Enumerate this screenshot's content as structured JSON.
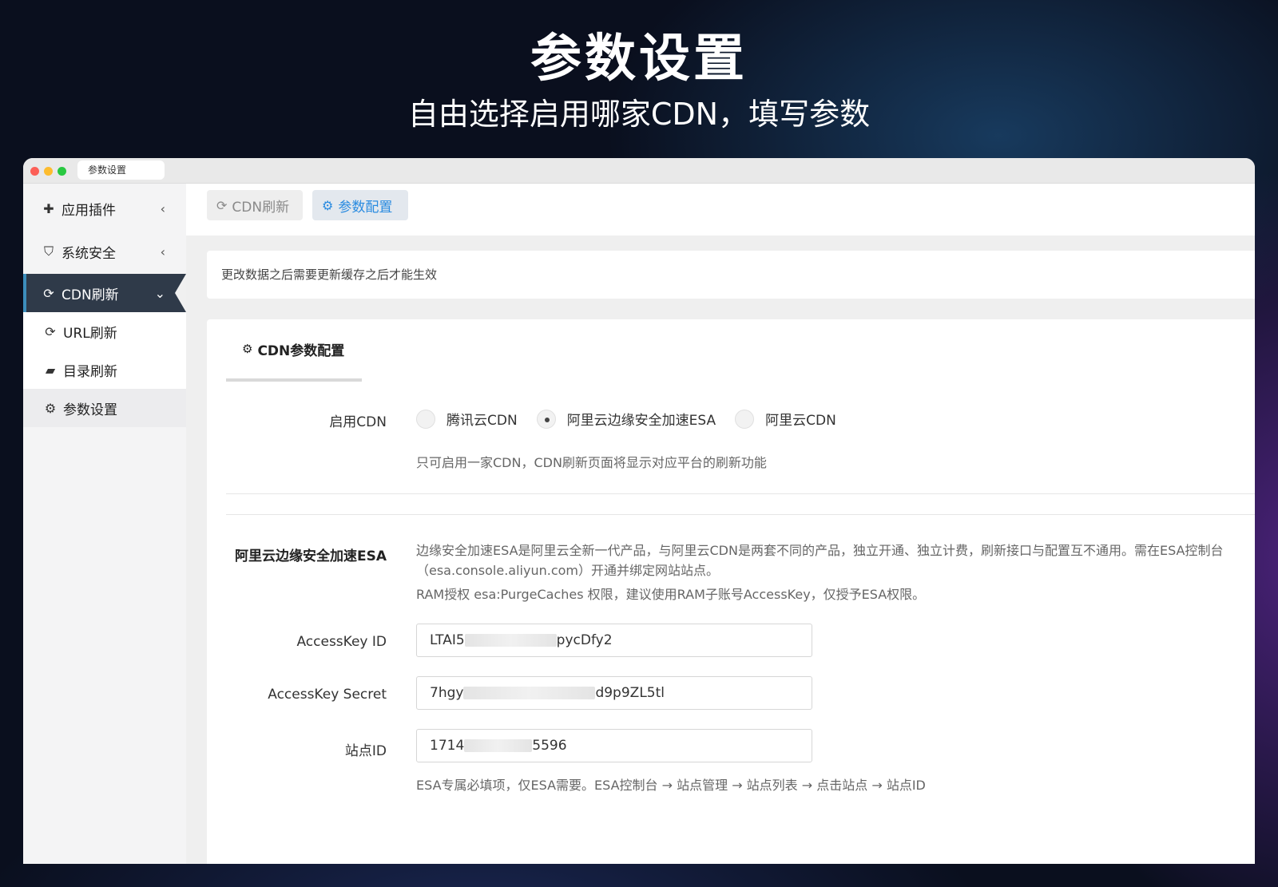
{
  "hero": {
    "title": "参数设置",
    "subtitle": "自由选择启用哪家CDN，填写参数"
  },
  "window": {
    "tab_title": "参数设置"
  },
  "sidebar": {
    "items": [
      {
        "label": "应用插件",
        "icon": "puzzle-icon",
        "chevron": "‹"
      },
      {
        "label": "系统安全",
        "icon": "shield-icon",
        "chevron": "‹"
      },
      {
        "label": "CDN刷新",
        "icon": "refresh-icon",
        "chevron": "⌄"
      },
      {
        "label": "URL刷新",
        "icon": "refresh-icon"
      },
      {
        "label": "目录刷新",
        "icon": "folder-open-icon"
      },
      {
        "label": "参数设置",
        "icon": "gear-icon"
      }
    ]
  },
  "topbar": {
    "tabs": [
      {
        "label": "CDN刷新",
        "icon": "refresh-icon"
      },
      {
        "label": "参数配置",
        "icon": "gear-icon"
      }
    ]
  },
  "notice": "更改数据之后需要更新缓存之后才能生效",
  "form": {
    "tab_title": "CDN参数配置",
    "enable_cdn": {
      "label": "启用CDN",
      "options": [
        "腾讯云CDN",
        "阿里云边缘安全加速ESA",
        "阿里云CDN"
      ],
      "selected": "阿里云边缘安全加速ESA",
      "help": "只可启用一家CDN，CDN刷新页面将显示对应平台的刷新功能"
    },
    "esa": {
      "section_label": "阿里云边缘安全加速ESA",
      "description": "边缘安全加速ESA是阿里云全新一代产品，与阿里云CDN是两套不同的产品，独立开通、独立计费，刷新接口与配置互不通用。需在ESA控制台（esa.console.aliyun.com）开通并绑定网站站点。",
      "ram_note": "RAM授权 esa:PurgeCaches 权限，建议使用RAM子账号AccessKey，仅授予ESA权限。",
      "access_key_id": {
        "label": "AccessKey ID",
        "value_start": "LTAI5",
        "value_end": "pycDfy2"
      },
      "access_key_secret": {
        "label": "AccessKey Secret",
        "value_start": "7hgy",
        "value_end": "d9p9ZL5tl"
      },
      "site_id": {
        "label": "站点ID",
        "value_start": "1714",
        "value_end": "5596"
      },
      "site_help": "ESA专属必填项，仅ESA需要。ESA控制台 → 站点管理 → 站点列表 → 点击站点 → 站点ID"
    }
  },
  "colors": {
    "sidebar_active_bg": "#2f3a49",
    "sidebar_active_accent": "#3c8dbc",
    "primary_link": "#2a8be0"
  }
}
